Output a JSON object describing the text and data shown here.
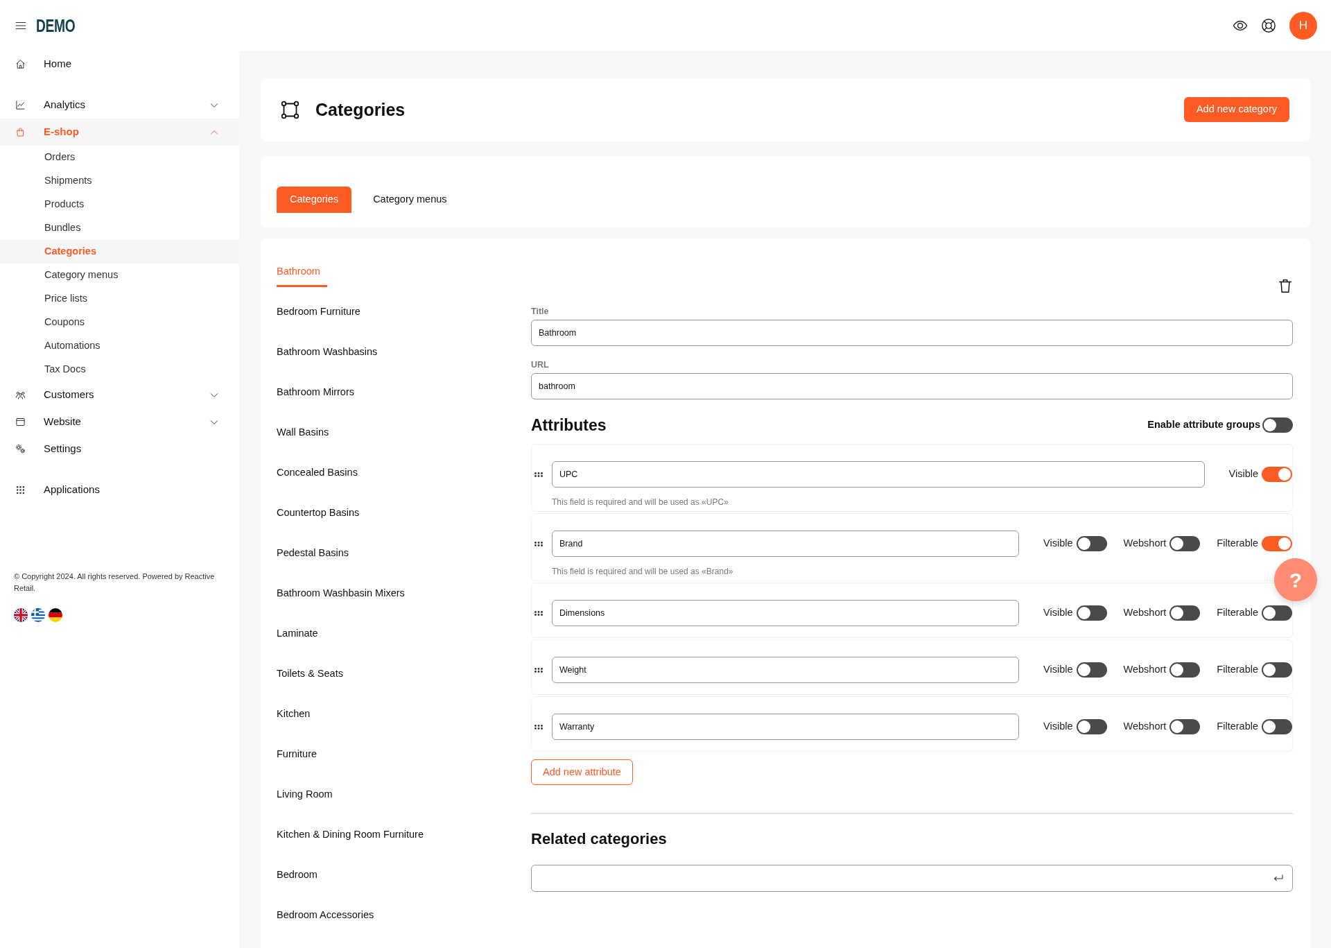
{
  "header": {
    "logo": "DEMO",
    "avatar": "H"
  },
  "sidebar": {
    "groups": [
      {
        "items": [
          {
            "label": "Home",
            "selected": false
          }
        ]
      },
      {
        "items": [
          {
            "label": "Analytics",
            "selected": false,
            "expanded": false
          },
          {
            "label": "E-shop",
            "selected": true,
            "expanded": true,
            "children": [
              {
                "label": "Orders",
                "selected": false
              },
              {
                "label": "Shipments",
                "selected": false
              },
              {
                "label": "Products",
                "selected": false
              },
              {
                "label": "Bundles",
                "selected": false
              },
              {
                "label": "Categories",
                "selected": true
              },
              {
                "label": "Category menus",
                "selected": false
              },
              {
                "label": "Price lists",
                "selected": false
              },
              {
                "label": "Coupons",
                "selected": false
              },
              {
                "label": "Automations",
                "selected": false
              },
              {
                "label": "Tax Docs",
                "selected": false
              }
            ]
          },
          {
            "label": "Customers",
            "selected": false,
            "expanded": false
          },
          {
            "label": "Website",
            "selected": false,
            "expanded": false
          },
          {
            "label": "Settings",
            "selected": false
          }
        ]
      },
      {
        "items": [
          {
            "label": "Applications",
            "selected": false
          }
        ]
      }
    ],
    "copyright": "© Copyright 2024. All rights reserved. Powered by Reactive Retail."
  },
  "page": {
    "title": "Categories",
    "add_button": "Add new category"
  },
  "tabs": [
    {
      "label": "Categories",
      "selected": true
    },
    {
      "label": "Category menus",
      "selected": false
    }
  ],
  "categories": [
    {
      "label": "Bathroom",
      "selected": true
    },
    {
      "label": "Bedroom Furniture",
      "selected": false
    },
    {
      "label": "Bathroom Washbasins",
      "selected": false
    },
    {
      "label": "Bathroom Mirrors",
      "selected": false
    },
    {
      "label": "Wall Basins",
      "selected": false
    },
    {
      "label": "Concealed Basins",
      "selected": false
    },
    {
      "label": "Countertop Basins",
      "selected": false
    },
    {
      "label": "Pedestal Basins",
      "selected": false
    },
    {
      "label": "Bathroom Washbasin Mixers",
      "selected": false
    },
    {
      "label": "Laminate",
      "selected": false
    },
    {
      "label": "Toilets & Seats",
      "selected": false
    },
    {
      "label": "Kitchen",
      "selected": false
    },
    {
      "label": "Furniture",
      "selected": false
    },
    {
      "label": "Living Room",
      "selected": false
    },
    {
      "label": "Kitchen & Dining Room Furniture",
      "selected": false
    },
    {
      "label": "Bedroom",
      "selected": false
    },
    {
      "label": "Bedroom Accessories",
      "selected": false
    }
  ],
  "form": {
    "title": {
      "label": "Title",
      "value": "Bathroom"
    },
    "url": {
      "label": "URL",
      "value": "bathroom"
    }
  },
  "attributes": {
    "heading": "Attributes",
    "groups_toggle": {
      "label": "Enable attribute groups",
      "on": false
    },
    "rows": [
      {
        "value": "UPC",
        "hint": "This field is required and will be used as «UPC»",
        "toggles": [
          {
            "label": "Visible",
            "on": true
          }
        ]
      },
      {
        "value": "Brand",
        "hint": "This field is required and will be used as «Brand»",
        "toggles": [
          {
            "label": "Visible",
            "on": false
          },
          {
            "label": "Webshort",
            "on": false
          },
          {
            "label": "Filterable",
            "on": true
          }
        ]
      },
      {
        "value": "Dimensions",
        "toggles": [
          {
            "label": "Visible",
            "on": false
          },
          {
            "label": "Webshort",
            "on": false
          },
          {
            "label": "Filterable",
            "on": false
          }
        ]
      },
      {
        "value": "Weight",
        "toggles": [
          {
            "label": "Visible",
            "on": false
          },
          {
            "label": "Webshort",
            "on": false
          },
          {
            "label": "Filterable",
            "on": false
          }
        ]
      },
      {
        "value": "Warranty",
        "toggles": [
          {
            "label": "Visible",
            "on": false
          },
          {
            "label": "Webshort",
            "on": false
          },
          {
            "label": "Filterable",
            "on": false
          }
        ]
      }
    ],
    "add_button": "Add new attribute"
  },
  "related": {
    "heading": "Related categories"
  },
  "help_button": "?"
}
